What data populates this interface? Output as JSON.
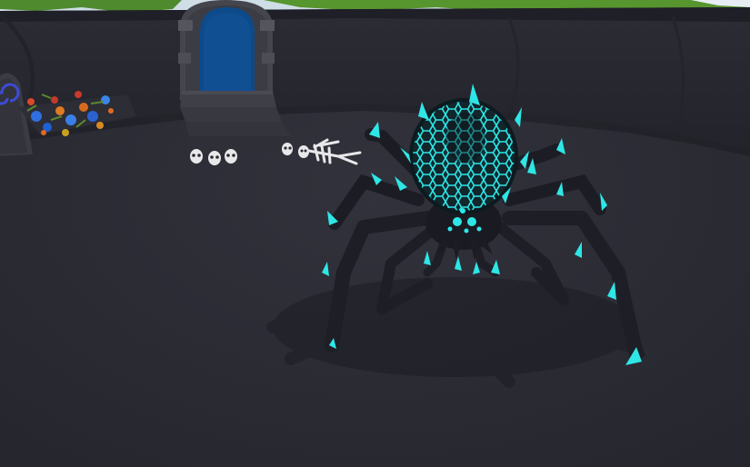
{
  "scene": {
    "colors": {
      "ground": "#2b2b34",
      "arena_wall": "#26262e",
      "wall_top": "#1e1e26",
      "grass": "#4f8a2e",
      "sky": "#d9e6ef",
      "door_stone": "#4a4a52",
      "door_blue": "#0d4a8a",
      "stairs": "#3a3a42",
      "spider_body": "#1c1c24",
      "spider_glow": "#2ee6e6",
      "bone": "#e8e8ea",
      "tombstone": "#3b3b44",
      "rune": "#3d4bd6"
    },
    "objects": [
      {
        "name": "arena-wall",
        "kind": "wall"
      },
      {
        "name": "stone-doorway",
        "kind": "door"
      },
      {
        "name": "skulls-pile",
        "kind": "decor",
        "count": 4
      },
      {
        "name": "skeleton",
        "kind": "decor"
      },
      {
        "name": "tombstone",
        "kind": "decor",
        "icon": "spiral-rune-icon"
      },
      {
        "name": "flower-bed",
        "kind": "decor"
      },
      {
        "name": "crystal-spider-boss",
        "kind": "enemy"
      }
    ]
  }
}
